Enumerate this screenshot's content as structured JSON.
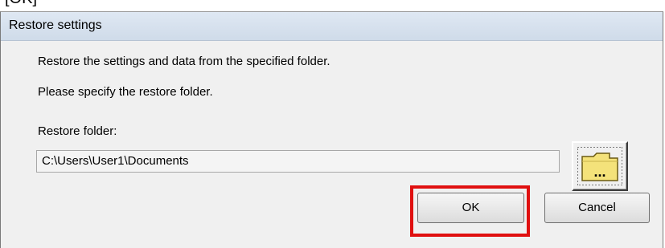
{
  "top_fragment": "[OK]",
  "dialog": {
    "title": "Restore settings",
    "line1": "Restore the settings and data from the specified folder.",
    "line2": "Please specify the restore folder.",
    "folder_label": "Restore folder:",
    "folder_value": "C:\\Users\\User1\\Documents",
    "browse_glyph": "...",
    "ok_label": "OK",
    "cancel_label": "Cancel"
  },
  "colors": {
    "highlight": "#e01010",
    "folder_fill": "#f4e27a"
  }
}
